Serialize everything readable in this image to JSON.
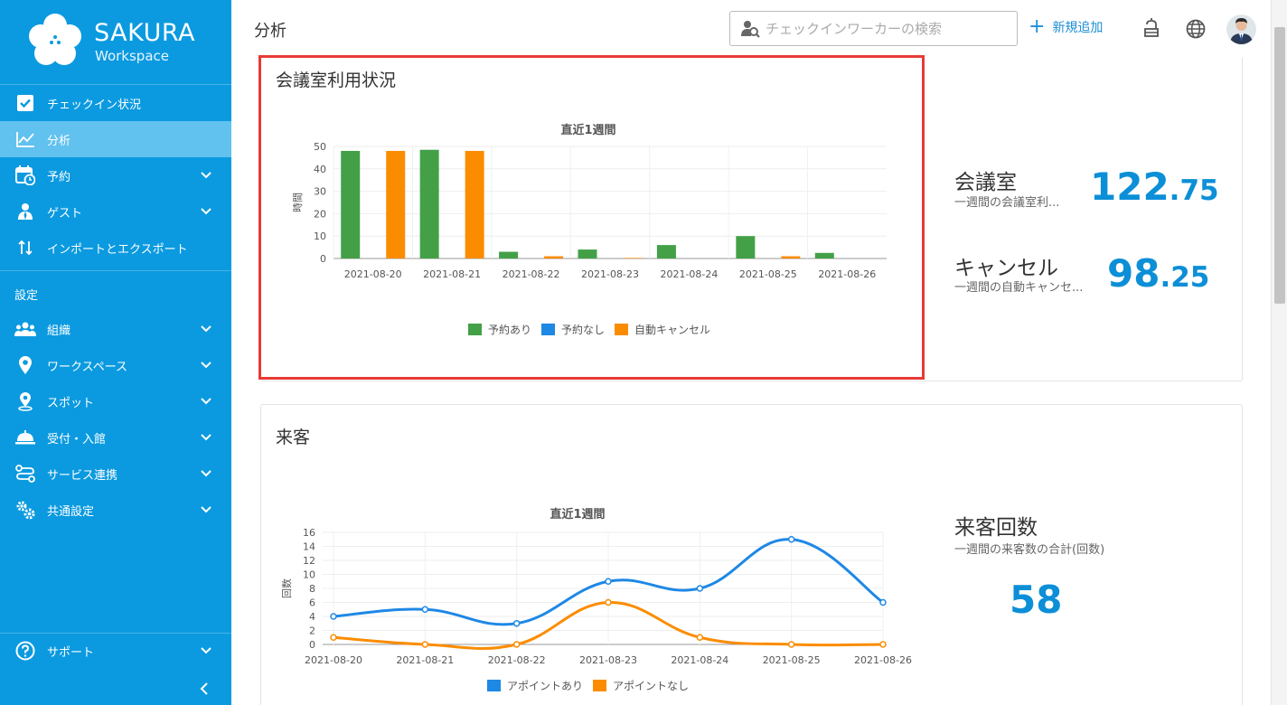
{
  "brand": {
    "name": "SAKURA",
    "sub": "Workspace"
  },
  "sidebar": {
    "items": [
      {
        "label": "チェックイン状況",
        "icon": "check-square-icon"
      },
      {
        "label": "分析",
        "icon": "line-chart-icon"
      },
      {
        "label": "予約",
        "icon": "calendar-icon"
      },
      {
        "label": "ゲスト",
        "icon": "guest-icon"
      },
      {
        "label": "インポートとエクスポート",
        "icon": "import-export-icon"
      }
    ],
    "settings_label": "設定",
    "settings_items": [
      {
        "label": "組織",
        "icon": "people-icon"
      },
      {
        "label": "ワークスペース",
        "icon": "location-pin-icon"
      },
      {
        "label": "スポット",
        "icon": "spot-pin-icon"
      },
      {
        "label": "受付・入館",
        "icon": "reception-bell-icon"
      },
      {
        "label": "サービス連携",
        "icon": "integration-icon"
      },
      {
        "label": "共通設定",
        "icon": "gears-icon"
      }
    ],
    "support_label": "サポート",
    "collapse_icon": "chevron-left-icon"
  },
  "header": {
    "title": "分析",
    "search_placeholder": "チェックインワーカーの検索",
    "add_label": "新規追加",
    "icons": [
      "bell-off-icon",
      "globe-icon",
      "user-avatar"
    ]
  },
  "colors": {
    "sidebar": "#0b9ae0",
    "active_item": "#61c1ef",
    "accent": "#0c8fd7",
    "highlight": "#e83a36",
    "green": "#43a047",
    "blue": "#1e88e5",
    "orange": "#fb8c00"
  },
  "meeting": {
    "title": "会議室利用状況",
    "stat1": {
      "title": "会議室",
      "desc": "一週間の会議室利...",
      "int": "122",
      "dec": ".75"
    },
    "stat2": {
      "title": "キャンセル",
      "desc": "一週間の自動キャンセ...",
      "int": "98",
      "dec": ".25"
    }
  },
  "visitors": {
    "title": "来客",
    "stat": {
      "title": "来客回数",
      "desc": "一週間の来客数の合計(回数)",
      "value": "58"
    }
  },
  "chart_data": [
    {
      "type": "bar",
      "title": "直近1週間",
      "ylabel": "時間",
      "ylim": [
        0,
        50
      ],
      "yticks": [
        0,
        10,
        20,
        30,
        40,
        50
      ],
      "categories": [
        "2021-08-20",
        "2021-08-21",
        "2021-08-22",
        "2021-08-23",
        "2021-08-24",
        "2021-08-25",
        "2021-08-26"
      ],
      "series": [
        {
          "name": "予約あり",
          "color": "#43a047",
          "values": [
            48,
            48.5,
            3,
            4,
            6,
            10,
            2.5
          ]
        },
        {
          "name": "予約なし",
          "color": "#1e88e5",
          "values": [
            0,
            0,
            0,
            0,
            0,
            0,
            0
          ]
        },
        {
          "name": "自動キャンセル",
          "color": "#fb8c00",
          "values": [
            48,
            48,
            1,
            0.25,
            0,
            1,
            0
          ]
        }
      ],
      "legend": "bottom",
      "grid": true
    },
    {
      "type": "line",
      "title": "直近1週間",
      "ylabel": "回数",
      "ylim": [
        0,
        16
      ],
      "yticks": [
        0,
        2,
        4,
        6,
        8,
        10,
        12,
        14,
        16
      ],
      "categories": [
        "2021-08-20",
        "2021-08-21",
        "2021-08-22",
        "2021-08-23",
        "2021-08-24",
        "2021-08-25",
        "2021-08-26"
      ],
      "series": [
        {
          "name": "アポイントあり",
          "color": "#1e88e5",
          "values": [
            4,
            5,
            3,
            9,
            8,
            15,
            6
          ]
        },
        {
          "name": "アポイントなし",
          "color": "#fb8c00",
          "values": [
            1,
            0,
            0,
            6,
            1,
            0,
            0
          ]
        }
      ],
      "legend": "bottom",
      "grid": true
    }
  ]
}
